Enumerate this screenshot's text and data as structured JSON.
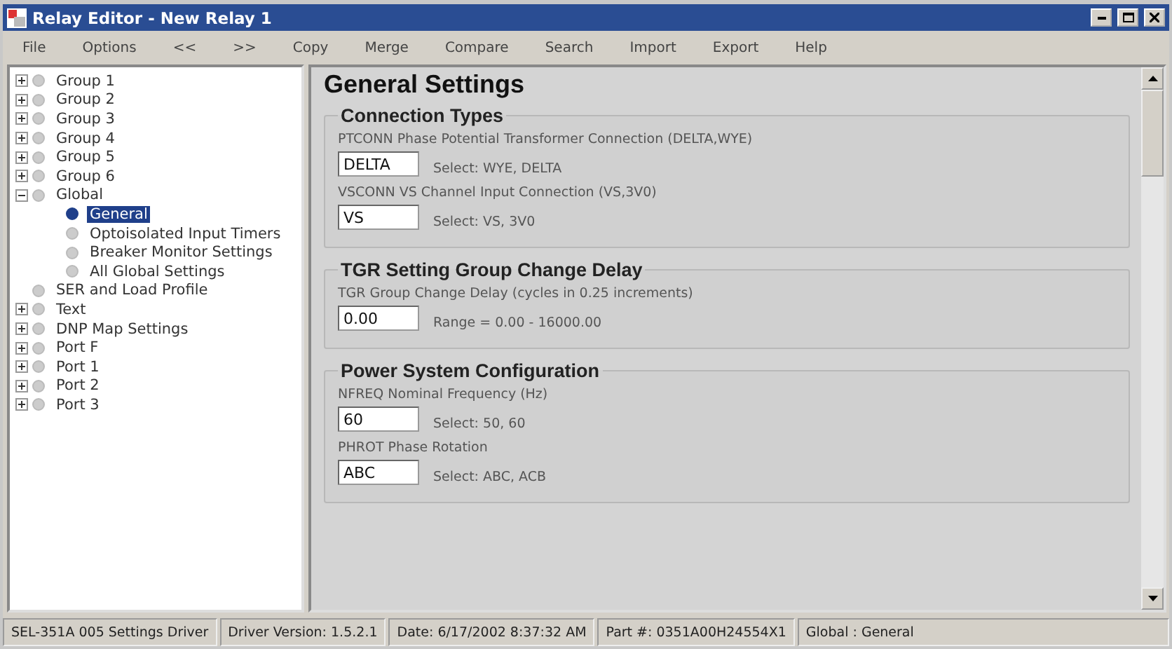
{
  "window": {
    "title": "Relay Editor - New Relay 1"
  },
  "menu": [
    "File",
    "Options",
    "<<",
    ">>",
    "Copy",
    "Merge",
    "Compare",
    "Search",
    "Import",
    "Export",
    "Help"
  ],
  "tree": [
    {
      "label": "Group 1",
      "expanded": false,
      "selected": false
    },
    {
      "label": "Group 2",
      "expanded": false,
      "selected": false
    },
    {
      "label": "Group 3",
      "expanded": false,
      "selected": false
    },
    {
      "label": "Group 4",
      "expanded": false,
      "selected": false
    },
    {
      "label": "Group 5",
      "expanded": false,
      "selected": false
    },
    {
      "label": "Group 6",
      "expanded": false,
      "selected": false
    },
    {
      "label": "Global",
      "expanded": true,
      "selected": false,
      "children": [
        {
          "label": "General",
          "selected": true
        },
        {
          "label": "Optoisolated Input Timers",
          "selected": false
        },
        {
          "label": "Breaker Monitor Settings",
          "selected": false
        },
        {
          "label": "All Global Settings",
          "selected": false
        }
      ]
    },
    {
      "label": "SER and Load Profile",
      "selected": false
    },
    {
      "label": "Text",
      "expanded": false,
      "selected": false
    },
    {
      "label": "DNP Map Settings",
      "expanded": false,
      "selected": false
    },
    {
      "label": "Port F",
      "expanded": false,
      "selected": false
    },
    {
      "label": "Port 1",
      "expanded": false,
      "selected": false
    },
    {
      "label": "Port 2",
      "expanded": false,
      "selected": false
    },
    {
      "label": "Port 3",
      "expanded": false,
      "selected": false
    }
  ],
  "page": {
    "title": "General Settings",
    "sections": [
      {
        "title": "Connection Types",
        "settings": [
          {
            "label": "PTCONN Phase Potential Transformer Connection (DELTA,WYE)",
            "value": "DELTA",
            "hint": "Select: WYE, DELTA"
          },
          {
            "label": "VSCONN VS Channel Input Connection (VS,3V0)",
            "value": "VS",
            "hint": "Select: VS, 3V0"
          }
        ]
      },
      {
        "title": "TGR Setting Group Change Delay",
        "settings": [
          {
            "label": "TGR Group Change Delay (cycles in 0.25 increments)",
            "value": "0.00",
            "hint": "Range = 0.00 - 16000.00"
          }
        ]
      },
      {
        "title": "Power System Configuration",
        "settings": [
          {
            "label": "NFREQ Nominal Frequency (Hz)",
            "value": "60",
            "hint": "Select: 50, 60"
          },
          {
            "label": "PHROT Phase Rotation",
            "value": "ABC",
            "hint": "Select: ABC, ACB"
          }
        ]
      }
    ]
  },
  "status_bar": [
    "SEL-351A 005 Settings Driver",
    "Driver Version: 1.5.2.1",
    "Date: 6/17/2002 8:37:32 AM",
    "Part #: 0351A00H24554X1",
    "Global : General"
  ]
}
